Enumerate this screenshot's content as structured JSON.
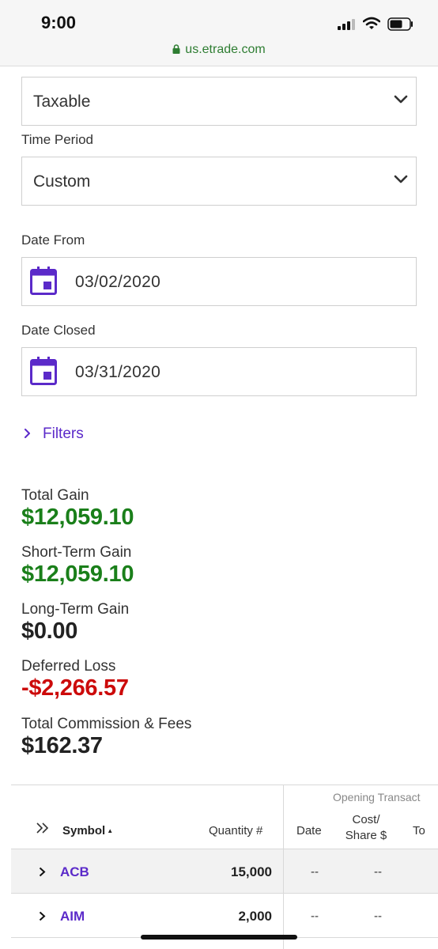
{
  "status_bar": {
    "time": "9:00",
    "signal_icon": "signal-icon",
    "wifi_icon": "wifi-icon",
    "battery_icon": "battery-icon"
  },
  "browser": {
    "url": "us.etrade.com",
    "lock_icon": "lock-icon"
  },
  "form": {
    "account_type": {
      "value": "Taxable"
    },
    "time_period": {
      "label": "Time Period",
      "value": "Custom"
    },
    "date_from": {
      "label": "Date From",
      "value": "03/02/2020"
    },
    "date_closed": {
      "label": "Date Closed",
      "value": "03/31/2020"
    },
    "filters_label": "Filters"
  },
  "summary": {
    "total_gain": {
      "label": "Total Gain",
      "value": "$12,059.10"
    },
    "short_term_gain": {
      "label": "Short-Term Gain",
      "value": "$12,059.10"
    },
    "long_term_gain": {
      "label": "Long-Term Gain",
      "value": "$0.00"
    },
    "deferred_loss": {
      "label": "Deferred Loss",
      "value": "-$2,266.57"
    },
    "commission_fees": {
      "label": "Total Commission & Fees",
      "value": "$162.37"
    }
  },
  "table": {
    "group_header": "Opening Transact",
    "columns": {
      "symbol": "Symbol",
      "quantity": "Quantity #",
      "date": "Date",
      "cost_line1": "Cost/",
      "cost_line2": "Share $",
      "total": "To"
    },
    "rows": [
      {
        "symbol": "ACB",
        "quantity": "15,000",
        "date": "--",
        "cost": "--"
      },
      {
        "symbol": "AIM",
        "quantity": "2,000",
        "date": "--",
        "cost": "--"
      }
    ]
  },
  "colors": {
    "accent": "#5b2ac9",
    "gain": "#1a7f1a",
    "loss": "#cc0a0a",
    "secure": "#2e7d32"
  }
}
